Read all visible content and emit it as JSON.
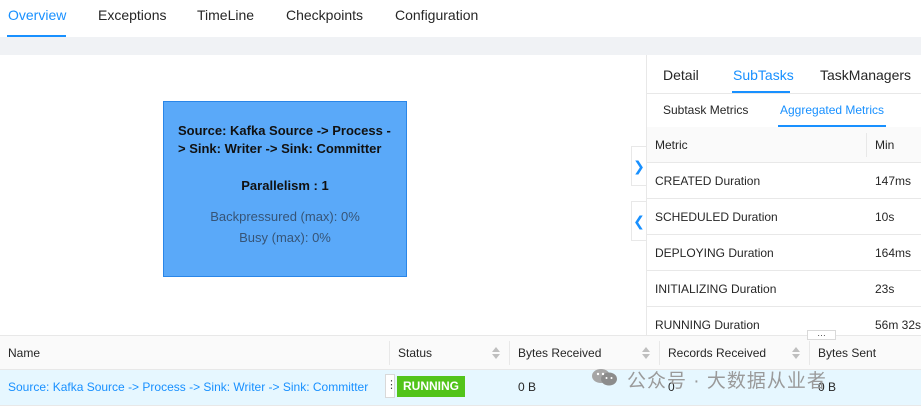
{
  "top_tabs": {
    "items": [
      "Overview",
      "Exceptions",
      "TimeLine",
      "Checkpoints",
      "Configuration"
    ],
    "active": "Overview"
  },
  "graph": {
    "node": {
      "title": "Source: Kafka Source -> Process -> Sink: Writer -> Sink: Committer",
      "parallelism": "Parallelism : 1",
      "backpressured": "Backpressured (max): 0%",
      "busy": "Busy (max): 0%"
    },
    "expand_icon": "chevron-right-icon",
    "collapse_icon": "chevron-left-icon"
  },
  "right_panel": {
    "tabs": [
      "Detail",
      "SubTasks",
      "TaskManagers"
    ],
    "active_tab": "SubTasks",
    "subtabs": [
      "Subtask Metrics",
      "Aggregated Metrics"
    ],
    "active_subtab": "Aggregated Metrics",
    "metrics_table": {
      "headers": [
        "Metric",
        "Min"
      ],
      "rows": [
        [
          "CREATED Duration",
          "147ms"
        ],
        [
          "SCHEDULED Duration",
          "10s"
        ],
        [
          "DEPLOYING Duration",
          "164ms"
        ],
        [
          "INITIALIZING Duration",
          "23s"
        ],
        [
          "RUNNING Duration",
          "56m 32s"
        ]
      ]
    }
  },
  "vertex_table": {
    "headers": [
      "Name",
      "Status",
      "Bytes Received",
      "Records Received",
      "Bytes Sent"
    ],
    "row": {
      "name": "Source: Kafka Source -> Process -> Sink: Writer -> Sink: Committer",
      "status": "RUNNING",
      "bytes_received": "0 B",
      "records_received": "0",
      "bytes_sent": "0 B"
    }
  },
  "watermark": {
    "text": "公众号 · 大数据从业者",
    "icon": "wechat-logo"
  },
  "colors": {
    "accent": "#1890ff",
    "node_fill": "#5aa9f9",
    "status_running": "#52c41a",
    "selected_row": "#e6f7ff"
  }
}
